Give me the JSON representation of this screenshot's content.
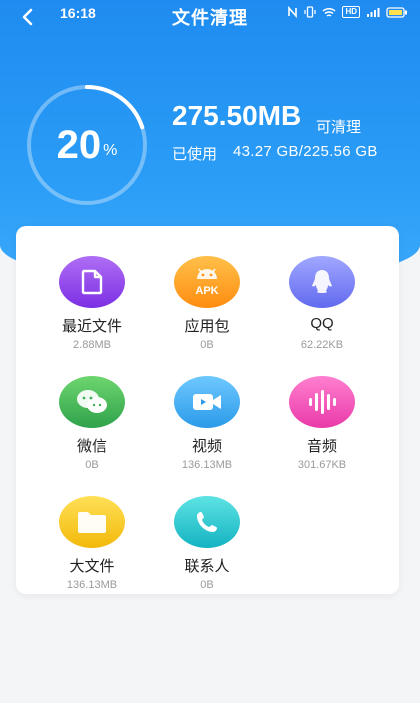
{
  "status_bar": {
    "time": "16:18",
    "network_label": "HD"
  },
  "header": {
    "title": "文件清理"
  },
  "summary": {
    "percent": "20",
    "percent_unit": "%",
    "cleanable_size": "275.50MB",
    "cleanable_label": "可清理",
    "used_label": "已使用",
    "used_value": "43.27 GB/225.56 GB"
  },
  "categories": [
    {
      "label": "最近文件",
      "size": "2.88MB",
      "icon": "document-icon"
    },
    {
      "label": "应用包",
      "size": "0B",
      "icon": "apk-android-icon"
    },
    {
      "label": "QQ",
      "size": "62.22KB",
      "icon": "qq-penguin-icon"
    },
    {
      "label": "微信",
      "size": "0B",
      "icon": "wechat-icon"
    },
    {
      "label": "视频",
      "size": "136.13MB",
      "icon": "video-camera-icon"
    },
    {
      "label": "音频",
      "size": "301.67KB",
      "icon": "audio-wave-icon"
    },
    {
      "label": "大文件",
      "size": "136.13MB",
      "icon": "folder-icon"
    },
    {
      "label": "联系人",
      "size": "0B",
      "icon": "phone-icon"
    }
  ],
  "colors": {
    "primary": "#2a9cf6",
    "background": "#f4f5f7"
  }
}
